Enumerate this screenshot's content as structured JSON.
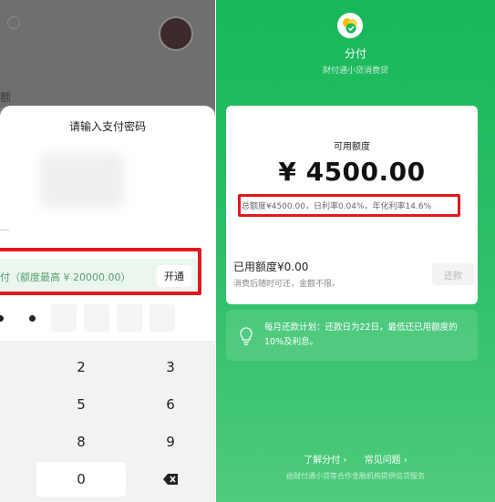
{
  "left": {
    "dim_edge_text": "额",
    "sheet_title": "请输入支付密码",
    "pay_row_text": "付（额度最高 ¥ 20000.00）",
    "pay_row_button": "开通",
    "keypad": [
      "2",
      "3",
      "5",
      "6",
      "8",
      "9",
      "0"
    ],
    "delete_icon": "backspace-icon"
  },
  "right": {
    "app_name": "分付",
    "app_subtitle": "财付通小贷消费贷",
    "available_label": "可用额度",
    "available_amount": "¥ 4500.00",
    "rate_line": "总额度¥4500.00，日利率0.04%，年化利率14.6%",
    "used_label": "已用额度¥0.00",
    "used_sub": "消费后随时可还，金额不限。",
    "repay_button": "还款",
    "notice": "每月还款计划：还款日为22日，最低还已用额度的10%及利息。",
    "link_learn": "了解分付 ›",
    "link_faq": "常见问题 ›",
    "footer": "由财付通小贷等合作金融机构提供信贷服务"
  },
  "colors": {
    "brand_green": "#18b85a",
    "highlight_red": "#e1191f"
  }
}
